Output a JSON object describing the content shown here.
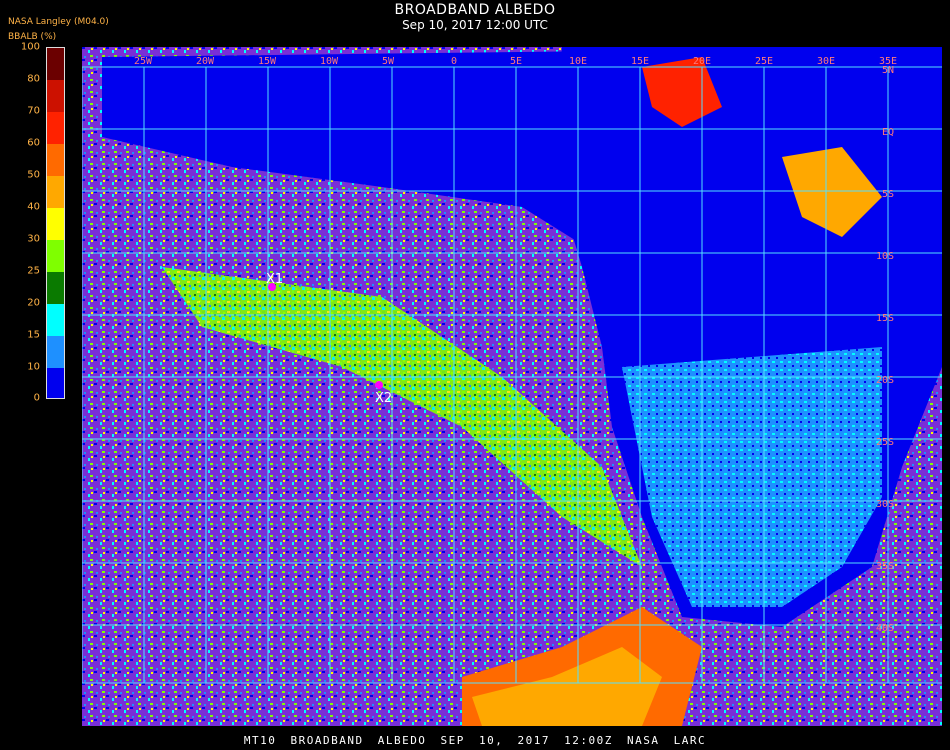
{
  "header": {
    "title": "BROADBAND ALBEDO",
    "subtitle": "Sep 10, 2017 12:00 UTC",
    "source": "NASA Langley (M04.0)",
    "unit": "BBALB (%)"
  },
  "legend": {
    "ticks": [
      "100",
      "80",
      "70",
      "60",
      "50",
      "40",
      "30",
      "25",
      "20",
      "15",
      "10",
      "0"
    ],
    "colors": [
      "#6b0000",
      "#cc1100",
      "#ff2200",
      "#ff6a00",
      "#ffa800",
      "#ffff00",
      "#7fff00",
      "#0a7a00",
      "#00ffff",
      "#1e90ff",
      "#0000ee",
      "#7a2fd6"
    ]
  },
  "map": {
    "grid_color": "#55e0ff",
    "lat_labels": [
      "5N",
      "EQ",
      "5S",
      "10S",
      "15S",
      "20S",
      "25S",
      "30S",
      "35S",
      "40S"
    ],
    "lon_labels": [
      "25W",
      "20W",
      "15W",
      "10W",
      "5W",
      "0",
      "5E",
      "10E",
      "15E",
      "20E",
      "25E",
      "30E",
      "35E"
    ],
    "markers": [
      {
        "label": "X1"
      },
      {
        "label": "X2"
      }
    ],
    "marker_color": "#ff00ff"
  },
  "footer": {
    "text": "MT10  BROADBAND ALBEDO   SEP 10, 2017 12:00Z   NASA LARC"
  }
}
